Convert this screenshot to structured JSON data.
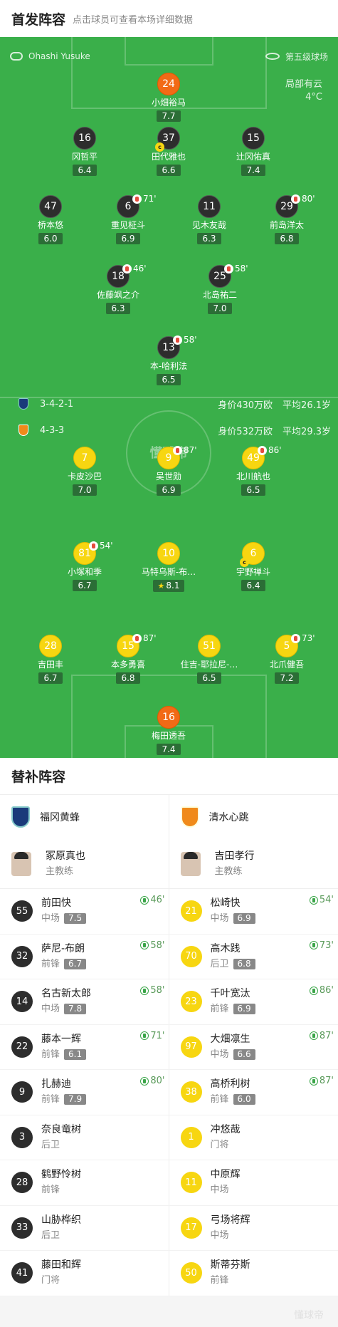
{
  "header": {
    "title": "首发阵容",
    "subtitle": "点击球员可查看本场详细数据"
  },
  "pitch": {
    "referee": "Ohashi Yusuke",
    "field_level": "第五级球场",
    "weather": "局部有云",
    "temperature": "4°C",
    "watermark": "懂球帝",
    "home": {
      "formation": "3-4-2-1",
      "value": "身价430万欧",
      "avg_age": "平均26.1岁"
    },
    "away": {
      "formation": "4-3-3",
      "value": "身价532万欧",
      "avg_age": "平均29.3岁"
    },
    "home_players": [
      {
        "num": "24",
        "name": "小畑裕马",
        "rating": "7.7",
        "color": "org"
      },
      {
        "num": "16",
        "name": "冈哲平",
        "rating": "6.4",
        "color": "dark"
      },
      {
        "num": "37",
        "name": "田代雅也",
        "rating": "6.6",
        "color": "dark",
        "captain": "c"
      },
      {
        "num": "15",
        "name": "辻冈佑真",
        "rating": "7.4",
        "color": "dark"
      },
      {
        "num": "47",
        "name": "桥本悠",
        "rating": "6.0",
        "color": "dark"
      },
      {
        "num": "6",
        "name": "重见柾斗",
        "rating": "6.9",
        "color": "dark",
        "sub": "71'"
      },
      {
        "num": "11",
        "name": "见木友哉",
        "rating": "6.3",
        "color": "dark"
      },
      {
        "num": "29",
        "name": "前岛洋太",
        "rating": "6.8",
        "color": "dark",
        "sub": "80'"
      },
      {
        "num": "18",
        "name": "佐藤飒之介",
        "rating": "6.3",
        "color": "dark",
        "sub": "46'"
      },
      {
        "num": "25",
        "name": "北岛祐二",
        "rating": "7.0",
        "color": "dark",
        "sub": "58'"
      },
      {
        "num": "13",
        "name": "本-哈利法",
        "rating": "6.5",
        "color": "dark",
        "sub": "58'"
      }
    ],
    "away_players": [
      {
        "num": "7",
        "name": "卡皮沙巴",
        "rating": "7.0",
        "color": "yel"
      },
      {
        "num": "9",
        "name": "吴世勋",
        "rating": "6.9",
        "color": "yel",
        "sub": "87'"
      },
      {
        "num": "49",
        "name": "北川航也",
        "rating": "6.5",
        "color": "yel",
        "sub": "86'"
      },
      {
        "num": "81",
        "name": "小塚和季",
        "rating": "6.7",
        "color": "yel",
        "sub": "54'"
      },
      {
        "num": "10",
        "name": "马特乌斯-布…",
        "rating": "8.1",
        "color": "yel",
        "star": "★"
      },
      {
        "num": "6",
        "name": "宇野禅斗",
        "rating": "6.4",
        "color": "yel",
        "captain": "c"
      },
      {
        "num": "28",
        "name": "吉田丰",
        "rating": "6.7",
        "color": "yel"
      },
      {
        "num": "15",
        "name": "本多勇喜",
        "rating": "6.8",
        "color": "yel",
        "sub": "87'"
      },
      {
        "num": "51",
        "name": "住吉-耶拉尼-…",
        "rating": "6.5",
        "color": "yel"
      },
      {
        "num": "5",
        "name": "北爪健吾",
        "rating": "7.2",
        "color": "yel",
        "sub": "73'"
      },
      {
        "num": "16",
        "name": "梅田透吾",
        "rating": "7.4",
        "color": "org"
      }
    ]
  },
  "subs": {
    "title": "替补阵容",
    "home": {
      "team": "福冈黄蜂",
      "coach": {
        "name": "冢原真也",
        "role": "主教练"
      },
      "players": [
        {
          "num": "55",
          "name": "前田快",
          "pos": "中场",
          "rating": "7.5",
          "in": "46'"
        },
        {
          "num": "32",
          "name": "萨尼-布朗",
          "pos": "前锋",
          "rating": "6.7",
          "in": "58'"
        },
        {
          "num": "14",
          "name": "名古新太郎",
          "pos": "中场",
          "rating": "7.8",
          "in": "58'"
        },
        {
          "num": "22",
          "name": "藤本一辉",
          "pos": "前锋",
          "rating": "6.1",
          "in": "71'"
        },
        {
          "num": "9",
          "name": "扎赫迪",
          "pos": "前锋",
          "rating": "7.9",
          "in": "80'"
        },
        {
          "num": "3",
          "name": "奈良竜树",
          "pos": "后卫"
        },
        {
          "num": "28",
          "name": "鹤野怜树",
          "pos": "前锋"
        },
        {
          "num": "33",
          "name": "山胁桦织",
          "pos": "后卫"
        },
        {
          "num": "41",
          "name": "藤田和辉",
          "pos": "门将"
        }
      ]
    },
    "away": {
      "team": "清水心跳",
      "coach": {
        "name": "吉田孝行",
        "role": "主教练"
      },
      "players": [
        {
          "num": "21",
          "name": "松崎快",
          "pos": "中场",
          "rating": "6.9",
          "in": "54'"
        },
        {
          "num": "70",
          "name": "高木践",
          "pos": "后卫",
          "rating": "6.8",
          "in": "73'"
        },
        {
          "num": "23",
          "name": "千叶宽汰",
          "pos": "前锋",
          "rating": "6.9",
          "in": "86'"
        },
        {
          "num": "97",
          "name": "大畑凛生",
          "pos": "中场",
          "rating": "6.6",
          "in": "87'"
        },
        {
          "num": "38",
          "name": "高桥利树",
          "pos": "前锋",
          "rating": "6.0",
          "in": "87'"
        },
        {
          "num": "1",
          "name": "冲悠哉",
          "pos": "门将"
        },
        {
          "num": "11",
          "name": "中原辉",
          "pos": "中场"
        },
        {
          "num": "17",
          "name": "弓场将辉",
          "pos": "中场"
        },
        {
          "num": "50",
          "name": "斯蒂芬斯",
          "pos": "前锋"
        }
      ]
    }
  },
  "footer": {
    "watermark": "懂球帝"
  }
}
